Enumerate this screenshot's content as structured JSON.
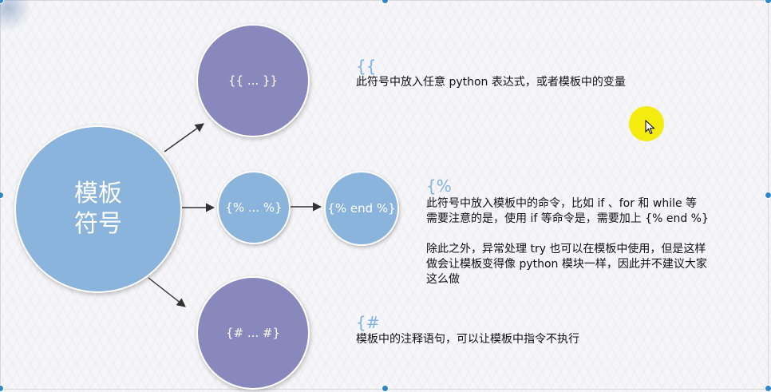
{
  "center": {
    "label": "模板\n符号"
  },
  "nodes": {
    "variable": {
      "label": "{{ ... }}"
    },
    "command": {
      "label": "{% ... %}"
    },
    "end": {
      "label": "{% end %}"
    },
    "comment": {
      "label": "{# ... #}"
    }
  },
  "notes": {
    "variable": {
      "symbol": "{{",
      "text": "此符号中放入任意 python 表达式，或者模板中的变量"
    },
    "command": {
      "symbol": "{%",
      "line1": "此符号中放入模板中的命令，比如 if 、for 和 while 等",
      "line2": "需要注意的是，使用 if 等命令是，需要加上 {% end %}",
      "line3": "除此之外，异常处理 try 也可以在模板中使用，但是这样",
      "line4": "做会让模板变得像 python 模块一样，因此并不建议大家",
      "line5": "这么做"
    },
    "comment": {
      "symbol": "{#",
      "text": "模板中的注释语句，可以让模板中指令不执行"
    }
  },
  "colors": {
    "blue_circle": "#8ab4dc",
    "purple_circle": "#8888bd",
    "symbol_text": "#7fb2e2",
    "cursor_highlight": "#f4ec0f"
  },
  "icons": {
    "cursor": "mouse-pointer-icon"
  }
}
